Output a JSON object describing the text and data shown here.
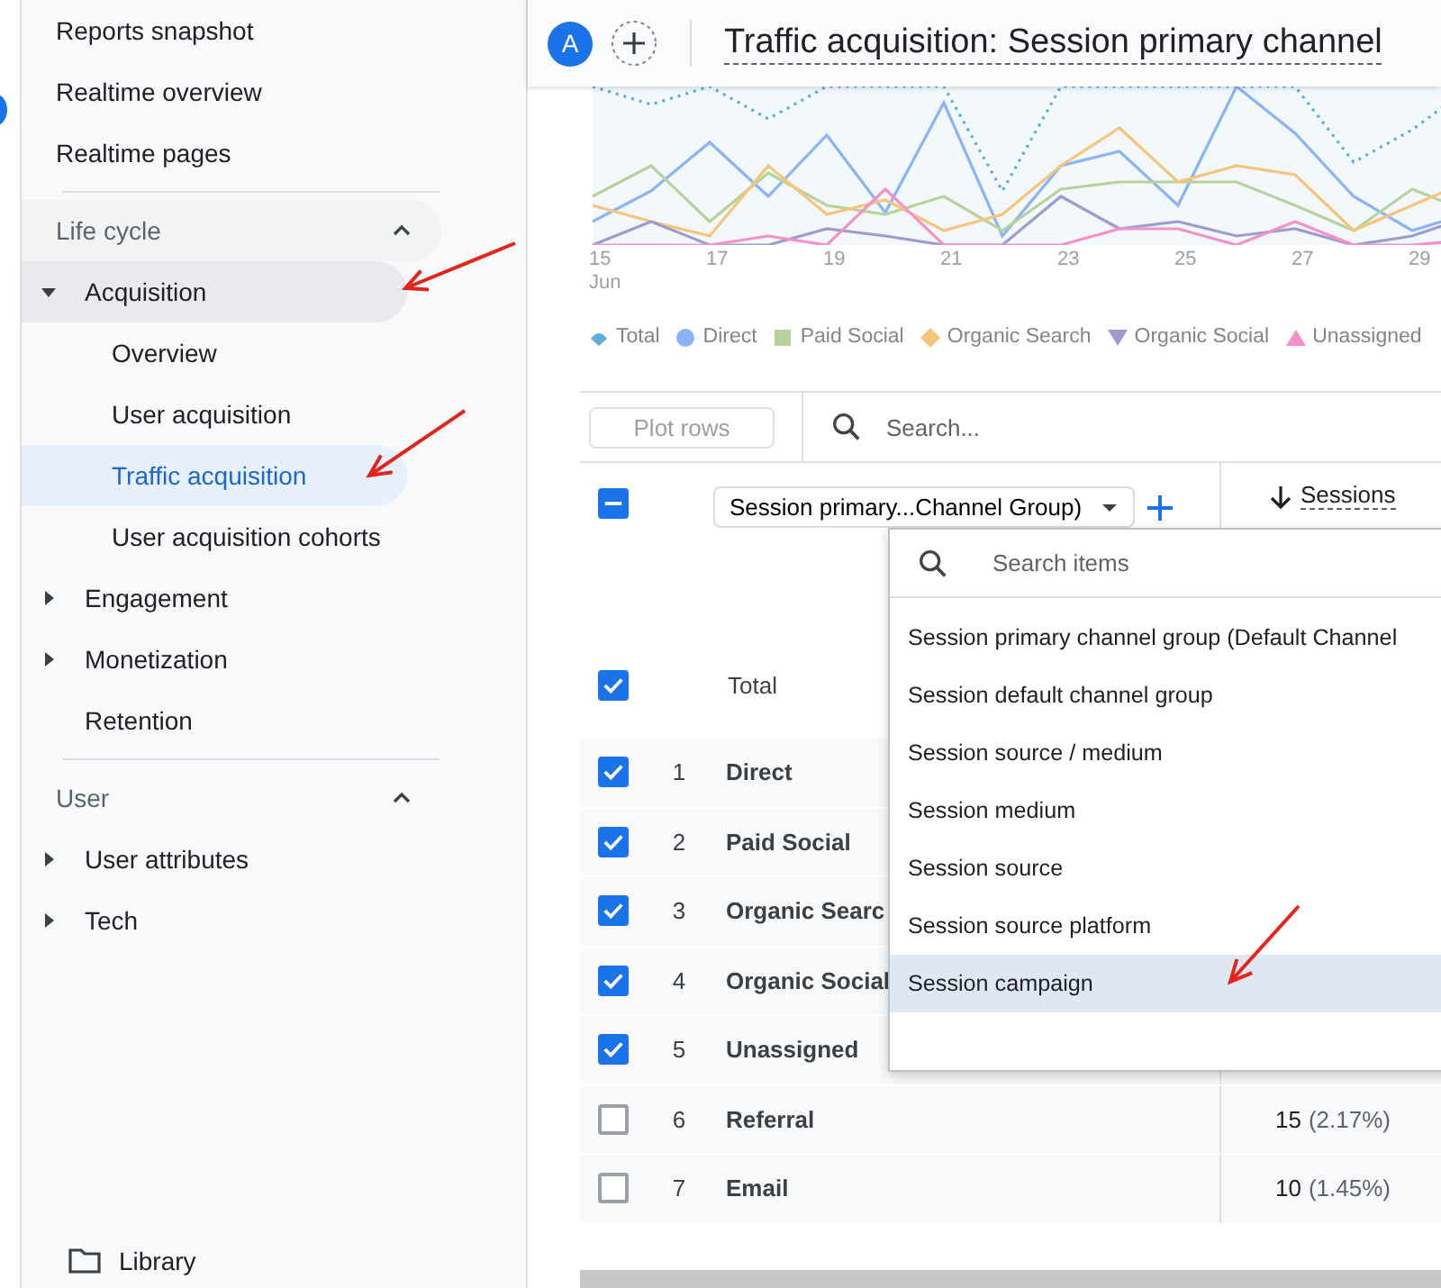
{
  "sidebar": {
    "top_items": [
      {
        "label": "Reports snapshot",
        "selected": false
      },
      {
        "label": "Realtime overview",
        "selected": false
      },
      {
        "label": "Realtime pages",
        "selected": false
      }
    ],
    "sections": [
      {
        "title": "Life cycle",
        "expanded": true,
        "items": [
          {
            "label": "Acquisition",
            "expanded": true,
            "highlighted": true,
            "children": [
              {
                "label": "Overview",
                "selected": false
              },
              {
                "label": "User acquisition",
                "selected": false
              },
              {
                "label": "Traffic acquisition",
                "selected": true
              },
              {
                "label": "User acquisition cohorts",
                "selected": false
              }
            ]
          },
          {
            "label": "Engagement",
            "expanded": false,
            "highlighted": false
          },
          {
            "label": "Monetization",
            "expanded": false,
            "highlighted": false
          },
          {
            "label": "Retention",
            "highlighted": false
          }
        ]
      },
      {
        "title": "User",
        "expanded": true,
        "items": [
          {
            "label": "User attributes",
            "expanded": false,
            "highlighted": false
          },
          {
            "label": "Tech",
            "expanded": false,
            "highlighted": false
          }
        ]
      }
    ],
    "footer": {
      "label": "Library"
    }
  },
  "header": {
    "avatar": "A",
    "title": "Traffic acquisition: Session primary channel"
  },
  "chart": {
    "x_labels": [
      "15",
      "17",
      "19",
      "21",
      "23",
      "25",
      "27",
      "29"
    ],
    "month": "Jun",
    "legend": [
      {
        "label": "Total",
        "kind": "drop",
        "color": "#5aaed8"
      },
      {
        "label": "Direct",
        "kind": "circle",
        "color": "#8ab4f8"
      },
      {
        "label": "Paid Social",
        "kind": "square",
        "color": "#b7d39c"
      },
      {
        "label": "Organic Search",
        "kind": "diamond",
        "color": "#f6c47a"
      },
      {
        "label": "Organic Social",
        "kind": "triangle-down",
        "color": "#9d9ccf"
      },
      {
        "label": "Unassigned",
        "kind": "triangle-up",
        "color": "#f391c8"
      }
    ]
  },
  "table": {
    "plot_rows": {
      "label": "Plot rows",
      "disabled": true
    },
    "search": {
      "placeholder": "Search..."
    },
    "select_all": {
      "indeterminate": true
    },
    "dimension": {
      "value": "Session primary...Channel Group)"
    },
    "metric": {
      "label": "Sessions",
      "sort_descending": true
    },
    "total": {
      "label": "Total",
      "checked": true
    },
    "rows": [
      {
        "index": "1",
        "name": "Direct",
        "checked": true
      },
      {
        "index": "2",
        "name": "Paid Social",
        "checked": true
      },
      {
        "index": "3",
        "name": "Organic Searc",
        "checked": true
      },
      {
        "index": "4",
        "name": "Organic Social",
        "checked": true
      },
      {
        "index": "5",
        "name": "Unassigned",
        "checked": true
      },
      {
        "index": "6",
        "name": "Referral",
        "checked": false,
        "sessions": "15",
        "share": "(2.17%)"
      },
      {
        "index": "7",
        "name": "Email",
        "checked": false,
        "sessions": "10",
        "share": "(1.45%)"
      }
    ]
  },
  "dimension_menu": {
    "search": {
      "placeholder": "Search items"
    },
    "items": [
      {
        "label": "Session primary channel group (Default Channel",
        "selected": false
      },
      {
        "label": "Session default channel group",
        "selected": false
      },
      {
        "label": "Session source / medium",
        "selected": false
      },
      {
        "label": "Session medium",
        "selected": false
      },
      {
        "label": "Session source",
        "selected": false
      },
      {
        "label": "Session source platform",
        "selected": false
      },
      {
        "label": "Session campaign",
        "selected": true
      }
    ]
  }
}
